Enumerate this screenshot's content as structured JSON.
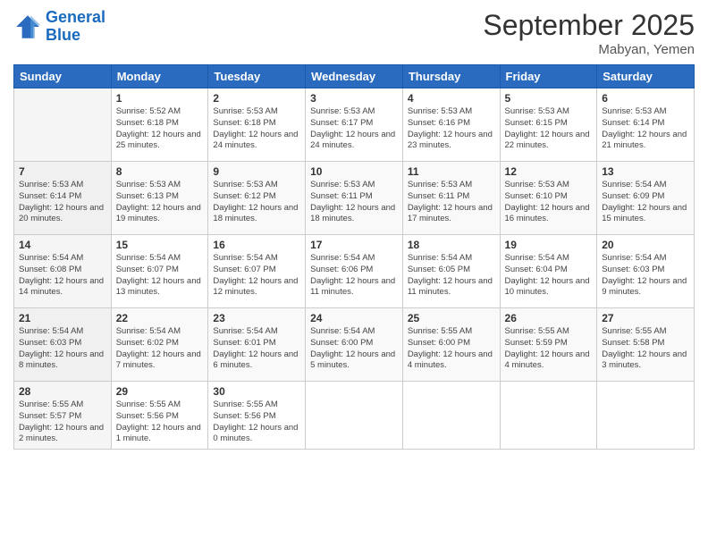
{
  "logo": {
    "line1": "General",
    "line2": "Blue"
  },
  "title": "September 2025",
  "subtitle": "Mabyan, Yemen",
  "days_header": [
    "Sunday",
    "Monday",
    "Tuesday",
    "Wednesday",
    "Thursday",
    "Friday",
    "Saturday"
  ],
  "weeks": [
    [
      {
        "num": "",
        "sunrise": "",
        "sunset": "",
        "daylight": ""
      },
      {
        "num": "1",
        "sunrise": "Sunrise: 5:52 AM",
        "sunset": "Sunset: 6:18 PM",
        "daylight": "Daylight: 12 hours and 25 minutes."
      },
      {
        "num": "2",
        "sunrise": "Sunrise: 5:53 AM",
        "sunset": "Sunset: 6:18 PM",
        "daylight": "Daylight: 12 hours and 24 minutes."
      },
      {
        "num": "3",
        "sunrise": "Sunrise: 5:53 AM",
        "sunset": "Sunset: 6:17 PM",
        "daylight": "Daylight: 12 hours and 24 minutes."
      },
      {
        "num": "4",
        "sunrise": "Sunrise: 5:53 AM",
        "sunset": "Sunset: 6:16 PM",
        "daylight": "Daylight: 12 hours and 23 minutes."
      },
      {
        "num": "5",
        "sunrise": "Sunrise: 5:53 AM",
        "sunset": "Sunset: 6:15 PM",
        "daylight": "Daylight: 12 hours and 22 minutes."
      },
      {
        "num": "6",
        "sunrise": "Sunrise: 5:53 AM",
        "sunset": "Sunset: 6:14 PM",
        "daylight": "Daylight: 12 hours and 21 minutes."
      }
    ],
    [
      {
        "num": "7",
        "sunrise": "Sunrise: 5:53 AM",
        "sunset": "Sunset: 6:14 PM",
        "daylight": "Daylight: 12 hours and 20 minutes."
      },
      {
        "num": "8",
        "sunrise": "Sunrise: 5:53 AM",
        "sunset": "Sunset: 6:13 PM",
        "daylight": "Daylight: 12 hours and 19 minutes."
      },
      {
        "num": "9",
        "sunrise": "Sunrise: 5:53 AM",
        "sunset": "Sunset: 6:12 PM",
        "daylight": "Daylight: 12 hours and 18 minutes."
      },
      {
        "num": "10",
        "sunrise": "Sunrise: 5:53 AM",
        "sunset": "Sunset: 6:11 PM",
        "daylight": "Daylight: 12 hours and 18 minutes."
      },
      {
        "num": "11",
        "sunrise": "Sunrise: 5:53 AM",
        "sunset": "Sunset: 6:11 PM",
        "daylight": "Daylight: 12 hours and 17 minutes."
      },
      {
        "num": "12",
        "sunrise": "Sunrise: 5:53 AM",
        "sunset": "Sunset: 6:10 PM",
        "daylight": "Daylight: 12 hours and 16 minutes."
      },
      {
        "num": "13",
        "sunrise": "Sunrise: 5:54 AM",
        "sunset": "Sunset: 6:09 PM",
        "daylight": "Daylight: 12 hours and 15 minutes."
      }
    ],
    [
      {
        "num": "14",
        "sunrise": "Sunrise: 5:54 AM",
        "sunset": "Sunset: 6:08 PM",
        "daylight": "Daylight: 12 hours and 14 minutes."
      },
      {
        "num": "15",
        "sunrise": "Sunrise: 5:54 AM",
        "sunset": "Sunset: 6:07 PM",
        "daylight": "Daylight: 12 hours and 13 minutes."
      },
      {
        "num": "16",
        "sunrise": "Sunrise: 5:54 AM",
        "sunset": "Sunset: 6:07 PM",
        "daylight": "Daylight: 12 hours and 12 minutes."
      },
      {
        "num": "17",
        "sunrise": "Sunrise: 5:54 AM",
        "sunset": "Sunset: 6:06 PM",
        "daylight": "Daylight: 12 hours and 11 minutes."
      },
      {
        "num": "18",
        "sunrise": "Sunrise: 5:54 AM",
        "sunset": "Sunset: 6:05 PM",
        "daylight": "Daylight: 12 hours and 11 minutes."
      },
      {
        "num": "19",
        "sunrise": "Sunrise: 5:54 AM",
        "sunset": "Sunset: 6:04 PM",
        "daylight": "Daylight: 12 hours and 10 minutes."
      },
      {
        "num": "20",
        "sunrise": "Sunrise: 5:54 AM",
        "sunset": "Sunset: 6:03 PM",
        "daylight": "Daylight: 12 hours and 9 minutes."
      }
    ],
    [
      {
        "num": "21",
        "sunrise": "Sunrise: 5:54 AM",
        "sunset": "Sunset: 6:03 PM",
        "daylight": "Daylight: 12 hours and 8 minutes."
      },
      {
        "num": "22",
        "sunrise": "Sunrise: 5:54 AM",
        "sunset": "Sunset: 6:02 PM",
        "daylight": "Daylight: 12 hours and 7 minutes."
      },
      {
        "num": "23",
        "sunrise": "Sunrise: 5:54 AM",
        "sunset": "Sunset: 6:01 PM",
        "daylight": "Daylight: 12 hours and 6 minutes."
      },
      {
        "num": "24",
        "sunrise": "Sunrise: 5:54 AM",
        "sunset": "Sunset: 6:00 PM",
        "daylight": "Daylight: 12 hours and 5 minutes."
      },
      {
        "num": "25",
        "sunrise": "Sunrise: 5:55 AM",
        "sunset": "Sunset: 6:00 PM",
        "daylight": "Daylight: 12 hours and 4 minutes."
      },
      {
        "num": "26",
        "sunrise": "Sunrise: 5:55 AM",
        "sunset": "Sunset: 5:59 PM",
        "daylight": "Daylight: 12 hours and 4 minutes."
      },
      {
        "num": "27",
        "sunrise": "Sunrise: 5:55 AM",
        "sunset": "Sunset: 5:58 PM",
        "daylight": "Daylight: 12 hours and 3 minutes."
      }
    ],
    [
      {
        "num": "28",
        "sunrise": "Sunrise: 5:55 AM",
        "sunset": "Sunset: 5:57 PM",
        "daylight": "Daylight: 12 hours and 2 minutes."
      },
      {
        "num": "29",
        "sunrise": "Sunrise: 5:55 AM",
        "sunset": "Sunset: 5:56 PM",
        "daylight": "Daylight: 12 hours and 1 minute."
      },
      {
        "num": "30",
        "sunrise": "Sunrise: 5:55 AM",
        "sunset": "Sunset: 5:56 PM",
        "daylight": "Daylight: 12 hours and 0 minutes."
      },
      {
        "num": "",
        "sunrise": "",
        "sunset": "",
        "daylight": ""
      },
      {
        "num": "",
        "sunrise": "",
        "sunset": "",
        "daylight": ""
      },
      {
        "num": "",
        "sunrise": "",
        "sunset": "",
        "daylight": ""
      },
      {
        "num": "",
        "sunrise": "",
        "sunset": "",
        "daylight": ""
      }
    ]
  ]
}
